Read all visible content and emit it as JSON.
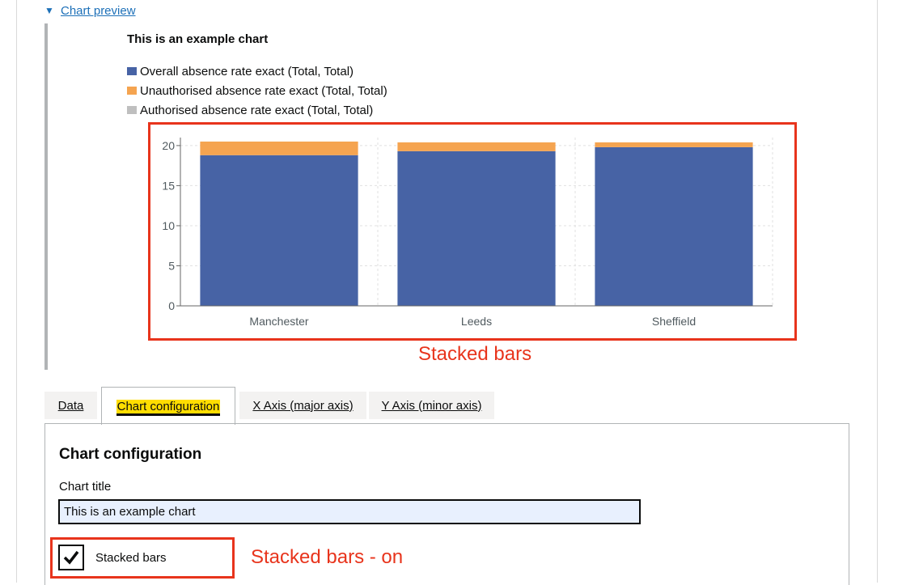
{
  "details": {
    "summary_label": "Chart preview",
    "expanded": true
  },
  "chart_data": {
    "type": "bar",
    "title": "This is an example chart",
    "categories": [
      "Manchester",
      "Leeds",
      "Sheffield"
    ],
    "series": [
      {
        "name": "Overall absence rate exact (Total, Total)",
        "color": "#4763a5",
        "values": [
          18.8,
          19.3,
          19.8
        ]
      },
      {
        "name": "Unauthorised absence rate exact (Total, Total)",
        "color": "#f5a450",
        "values": [
          1.7,
          1.1,
          0.6
        ]
      },
      {
        "name": "Authorised absence rate exact (Total, Total)",
        "color": "#bfbfbf",
        "values": [
          0,
          0,
          0
        ]
      }
    ],
    "stacked": true,
    "yticks": [
      "0",
      "5",
      "10",
      "15",
      "20"
    ],
    "ylim": [
      0,
      21
    ],
    "xlabel": "",
    "ylabel": "",
    "grid": true,
    "legend_position": "top"
  },
  "annotations": {
    "chart_note": "Stacked bars",
    "checkbox_note": "Stacked bars - on",
    "color": "#e8341c"
  },
  "tabs": [
    {
      "label": "Data",
      "active": false
    },
    {
      "label": "Chart configuration",
      "active": true
    },
    {
      "label": "X Axis (major axis)",
      "active": false
    },
    {
      "label": "Y Axis (minor axis)",
      "active": false
    }
  ],
  "config": {
    "heading": "Chart configuration",
    "title_field_label": "Chart title",
    "title_field_value": "This is an example chart",
    "stacked_label": "Stacked bars",
    "stacked_checked": true
  }
}
